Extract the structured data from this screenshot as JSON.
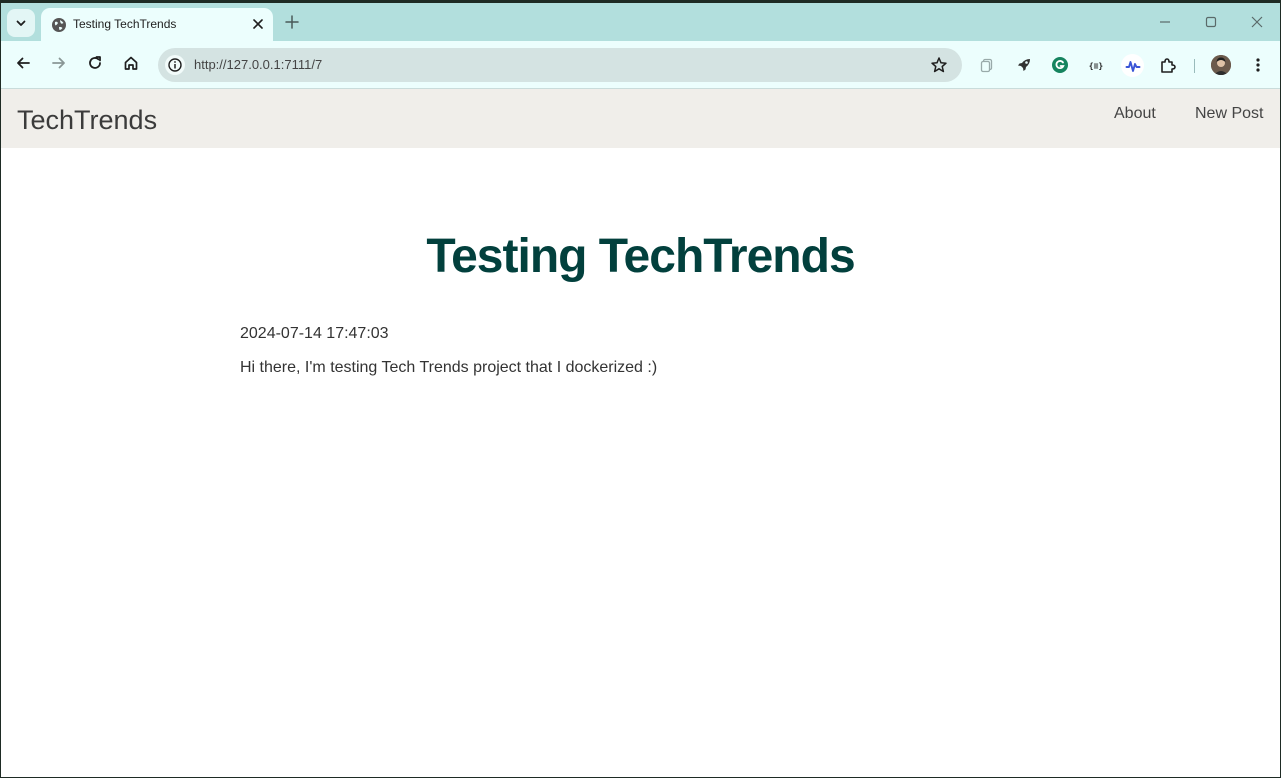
{
  "browser": {
    "tab_title": "Testing TechTrends",
    "url": "http://127.0.0.1:7111/7",
    "colors": {
      "tabstrip": "#b2dfdd",
      "toolbar": "#ecfefd",
      "omnibox": "#d4e3e2"
    }
  },
  "site": {
    "brand": "TechTrends",
    "nav": [
      {
        "label": "About"
      },
      {
        "label": "New Post"
      }
    ],
    "colors": {
      "navbar": "#f0eeea",
      "title": "#02403d"
    }
  },
  "post": {
    "title": "Testing TechTrends",
    "date": "2024-07-14 17:47:03",
    "body": "Hi there, I'm testing Tech Trends project that I dockerized :)"
  }
}
